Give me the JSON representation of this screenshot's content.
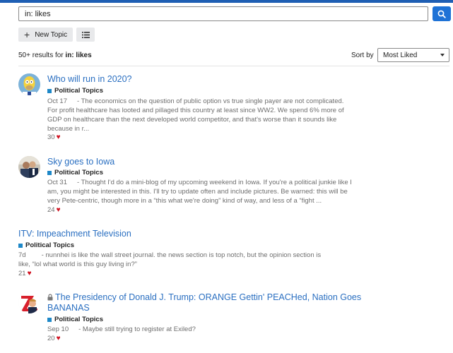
{
  "search": {
    "value": "in: likes"
  },
  "toolbar": {
    "new_topic_label": "New Topic"
  },
  "results": {
    "prefix": "50+ results for ",
    "query": "in: likes"
  },
  "sort": {
    "label": "Sort by",
    "selected": "Most Liked"
  },
  "colors": {
    "accent": "#1e72d6",
    "link": "#2a6fc1",
    "category": "#1e88c8",
    "heart": "#d0101f",
    "topbar": "#1f5fb4"
  },
  "topics": [
    {
      "title": "Who will run in 2020?",
      "category": "Political Topics",
      "date": "Oct 17",
      "excerpt_lines": [
        "- The economics on the question of public option vs true single payer are not complicated.",
        "For profit healthcare has looted and pillaged this country at least since WW2. We spend 6% more of",
        "GDP on healthcare than the next developed world competitor, and that's worse than it sounds like",
        "because in r..."
      ],
      "likes": "30",
      "avatar": "simpsons-avatar"
    },
    {
      "title": "Sky goes to Iowa",
      "category": "Political Topics",
      "date": "Oct 31",
      "excerpt_lines": [
        "- Thought I'd do a mini-blog of my upcoming weekend in Iowa. If you're a political junkie like I",
        "am, you might be interested in this. I'll try to update often and include pictures. Be warned: this will be",
        "very Pete-centric, though more in a “this what we're doing” kind of way, and less of a “fight ..."
      ],
      "likes": "24",
      "avatar": "photo-avatar"
    },
    {
      "title": "ITV: Impeachment Television",
      "category": "Political Topics",
      "date": "7d",
      "excerpt_lines": [
        "- nunnhei is like the wall street journal. the news section is top notch, but the opinion section is",
        "like, “lol what world is this guy living in?”"
      ],
      "likes": "21",
      "avatar": ""
    },
    {
      "title_lines": [
        "The Presidency of Donald J. Trump: ORANGE Gettin' PEACHed, Nation Goes",
        "BANANAS"
      ],
      "category": "Political Topics",
      "date": "Sep 10",
      "excerpt_lines": [
        "- Maybe still trying to register at Exiled?"
      ],
      "likes": "20",
      "avatar": "trump-avatar"
    }
  ]
}
